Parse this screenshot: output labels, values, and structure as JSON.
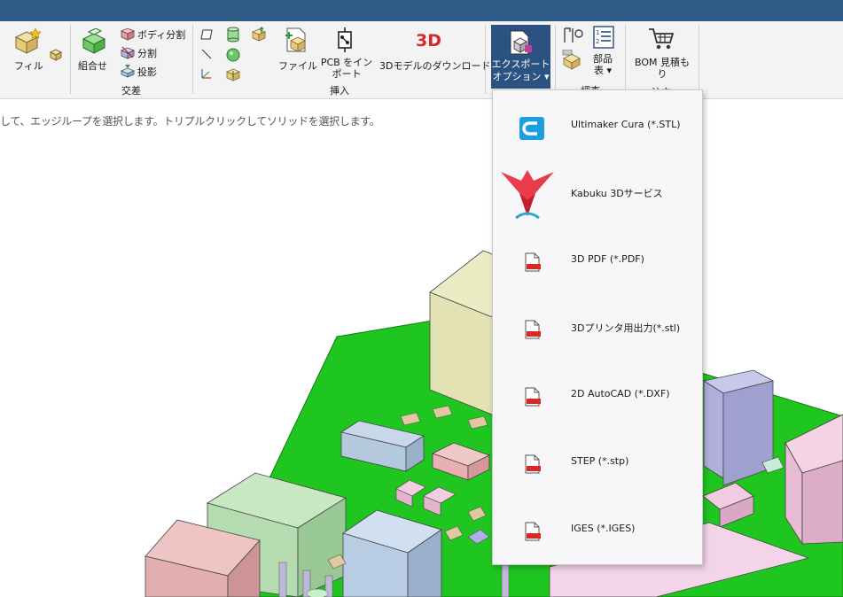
{
  "ribbon": {
    "fill_label": "フィル",
    "combine_label": "組合せ",
    "body_split_label": "ボディ分割",
    "split_label": "分割",
    "project_label": "投影",
    "intersect_group_label": "交差",
    "file_label": "ファイル",
    "pcb_import_line1": "PCB をイン",
    "pcb_import_line2": "ポート",
    "insert_group_label": "挿入",
    "download_3d_label": "3Dモデルのダウンロード",
    "export_line1": "エクスポート",
    "export_line2": "オプション ▾",
    "parts_line1": "部品",
    "parts_line2": "表 ▾",
    "investigate_group_label": "調査",
    "bom_line1": "BOM 見積も",
    "bom_line2": "り",
    "order_group_label": "注文"
  },
  "hint": "して、エッジループを選択します。トリプルクリックしてソリッドを選択します。",
  "menu": {
    "items": [
      {
        "label": "Ultimaker Cura (*.STL)",
        "icon": "cura-icon"
      },
      {
        "label": "Kabuku 3Dサービス",
        "icon": "kabuku-icon"
      },
      {
        "label": "3D PDF (*.PDF)",
        "icon": "pdf-file-icon"
      },
      {
        "label": "3Dプリンタ用出力(*.stl)",
        "icon": "stl-file-icon"
      },
      {
        "label": "2D AutoCAD (*.DXF)",
        "icon": "dxf-file-icon"
      },
      {
        "label": "STEP (*.stp)",
        "icon": "stp-file-icon"
      },
      {
        "label": "IGES (*.IGES)",
        "icon": "iges-file-icon"
      }
    ]
  },
  "colors": {
    "titlebar": "#2e5a87",
    "export_active": "#2c5282",
    "pcb_green": "#1fc61f"
  }
}
